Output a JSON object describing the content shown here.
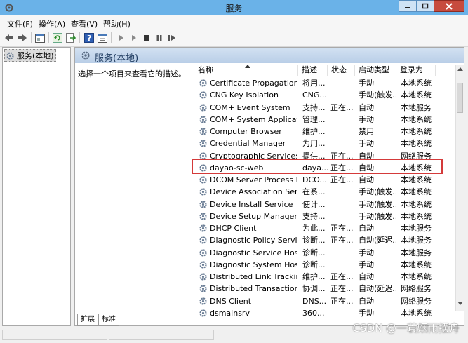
{
  "window": {
    "title": "服务"
  },
  "menu": [
    "文件(F)",
    "操作(A)",
    "查看(V)",
    "帮助(H)"
  ],
  "toolbar_icons": [
    "back-arrow-icon",
    "forward-arrow-icon",
    "show-hide-tree-icon",
    "refresh-icon",
    "export-list-icon",
    "help-icon",
    "properties-icon",
    "start-service-icon",
    "start-alt-icon",
    "stop-service-icon",
    "pause-service-icon",
    "restart-service-icon"
  ],
  "tree": {
    "root": "服务(本地)"
  },
  "panel": {
    "title": "服务(本地)",
    "description": "选择一个项目来查看它的描述。"
  },
  "columns": [
    "名称",
    "描述",
    "状态",
    "启动类型",
    "登录为"
  ],
  "services": [
    {
      "name": "Certificate Propagation",
      "desc": "将用...",
      "status": "",
      "startup": "手动",
      "logon": "本地系统"
    },
    {
      "name": "CNG Key Isolation",
      "desc": "CNG...",
      "status": "",
      "startup": "手动(触发...",
      "logon": "本地系统"
    },
    {
      "name": "COM+ Event System",
      "desc": "支持...",
      "status": "正在...",
      "startup": "自动",
      "logon": "本地服务"
    },
    {
      "name": "COM+ System Application",
      "desc": "管理...",
      "status": "",
      "startup": "手动",
      "logon": "本地系统"
    },
    {
      "name": "Computer Browser",
      "desc": "维护...",
      "status": "",
      "startup": "禁用",
      "logon": "本地系统"
    },
    {
      "name": "Credential Manager",
      "desc": "为用...",
      "status": "",
      "startup": "手动",
      "logon": "本地系统"
    },
    {
      "name": "Cryptographic Services",
      "desc": "提供...",
      "status": "正在...",
      "startup": "自动",
      "logon": "网络服务"
    },
    {
      "name": "dayao-sc-web",
      "desc": "daya...",
      "status": "正在...",
      "startup": "自动",
      "logon": "本地系统"
    },
    {
      "name": "DCOM Server Process La...",
      "desc": "DCO...",
      "status": "正在...",
      "startup": "自动",
      "logon": "本地系统"
    },
    {
      "name": "Device Association Service",
      "desc": "在系...",
      "status": "",
      "startup": "手动(触发...",
      "logon": "本地系统"
    },
    {
      "name": "Device Install Service",
      "desc": "使计...",
      "status": "",
      "startup": "手动(触发...",
      "logon": "本地系统"
    },
    {
      "name": "Device Setup Manager",
      "desc": "支持...",
      "status": "",
      "startup": "手动(触发...",
      "logon": "本地系统"
    },
    {
      "name": "DHCP Client",
      "desc": "为此...",
      "status": "正在...",
      "startup": "自动",
      "logon": "本地服务"
    },
    {
      "name": "Diagnostic Policy Service",
      "desc": "诊断...",
      "status": "正在...",
      "startup": "自动(延迟...",
      "logon": "本地服务"
    },
    {
      "name": "Diagnostic Service Host",
      "desc": "诊断...",
      "status": "",
      "startup": "手动",
      "logon": "本地服务"
    },
    {
      "name": "Diagnostic System Host",
      "desc": "诊断...",
      "status": "",
      "startup": "手动",
      "logon": "本地系统"
    },
    {
      "name": "Distributed Link Tracking...",
      "desc": "维护...",
      "status": "正在...",
      "startup": "自动",
      "logon": "本地系统"
    },
    {
      "name": "Distributed Transaction C...",
      "desc": "协调...",
      "status": "正在...",
      "startup": "自动(延迟...",
      "logon": "网络服务"
    },
    {
      "name": "DNS Client",
      "desc": "DNS...",
      "status": "正在...",
      "startup": "自动",
      "logon": "网络服务"
    },
    {
      "name": "dsmainsrv",
      "desc": "360...",
      "status": "",
      "startup": "手动",
      "logon": "本地系统"
    }
  ],
  "tabs": [
    "扩展",
    "标准"
  ],
  "watermark": "CSDN @一蓑烟雨摆舟"
}
